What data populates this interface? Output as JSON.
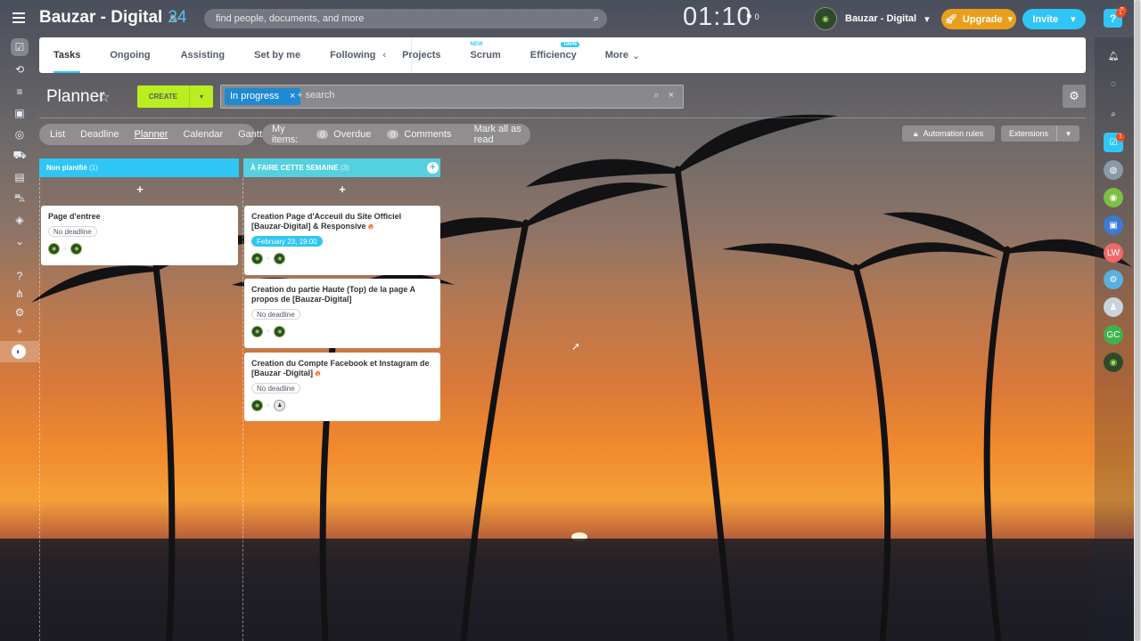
{
  "header": {
    "company_name": "Bauzar - Digital",
    "company_number": "24",
    "search_placeholder": "find people, documents, and more",
    "clock": "01:10",
    "flag_count": "0",
    "user_company": "Bauzar - Digital",
    "upgrade_label": "Upgrade",
    "invite_label": "Invite",
    "help_label": "?",
    "help_badge": "5",
    "brand_color": "#2fc6f6",
    "upgrade_color": "#e8a01c"
  },
  "nav": {
    "tabs": [
      {
        "label": "Tasks",
        "active": true
      },
      {
        "label": "Ongoing"
      },
      {
        "label": "Assisting"
      },
      {
        "label": "Set by me"
      },
      {
        "label": "Following"
      },
      {
        "label": "Projects"
      },
      {
        "label": "Scrum",
        "sup": "NEW"
      },
      {
        "label": "Efficiency",
        "sup": "100%"
      },
      {
        "label": "More"
      }
    ]
  },
  "toolbar": {
    "title": "Planner",
    "create_label": "CREATE",
    "filter_tag": "In progress",
    "filter_placeholder": "+ search",
    "create_color": "#bbed21"
  },
  "views": {
    "items": [
      "List",
      "Deadline",
      "Planner",
      "Calendar",
      "Gantt"
    ],
    "current": "Planner",
    "my_items_label": "My items:",
    "overdue_count": "0",
    "overdue_label": "Overdue",
    "comments_count": "0",
    "comments_label": "Comments",
    "mark_read_label": "Mark all as read",
    "automation_label": "Automation rules",
    "extensions_label": "Extensions"
  },
  "columns": [
    {
      "title": "Non planifié",
      "count": "(1)",
      "color": "#2fc6f6",
      "cards": [
        {
          "title": "Page d'entree",
          "hot": false,
          "deadline": "No deadline",
          "deadline_set": false
        }
      ]
    },
    {
      "title": "À FAIRE CETTE SEMAINE",
      "count": "(3)",
      "color": "#55d0e0",
      "cards": [
        {
          "title": "Creation Page d'Acceuil du Site Officiel [Bauzar-Digital] & Responsive",
          "hot": true,
          "deadline": "February 23, 19:00",
          "deadline_set": true
        },
        {
          "title": "Creation du partie Haute (Top) de la page A propos de [Bauzar-Digital]",
          "hot": false,
          "deadline": "No deadline",
          "deadline_set": false
        },
        {
          "title": "Creation du Compte Facebook et Instagram de [Bauzar -Digital]",
          "hot": true,
          "deadline": "No deadline",
          "deadline_set": false
        }
      ]
    }
  ],
  "rightbar": {
    "notif_badge": "1",
    "tasks_badge": "1",
    "initials_1": "LW",
    "initials_2": "GC"
  }
}
